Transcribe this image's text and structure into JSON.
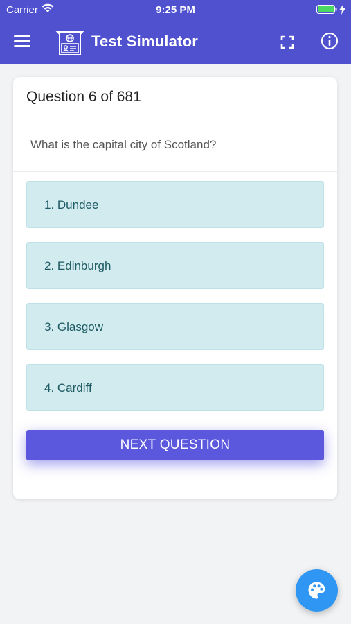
{
  "status_bar": {
    "carrier": "Carrier",
    "time": "9:25 PM"
  },
  "app_bar": {
    "title": "Test Simulator",
    "icons": [
      "menu-icon",
      "logo-icon",
      "fullscreen-icon",
      "info-icon"
    ]
  },
  "card": {
    "header": "Question 6 of 681",
    "question": "What is the capital city of Scotland?",
    "answers": [
      {
        "label": "1. Dundee"
      },
      {
        "label": "2. Edinburgh"
      },
      {
        "label": "3. Glasgow"
      },
      {
        "label": "4. Cardiff"
      }
    ],
    "next_label": "NEXT QUESTION"
  },
  "fab": {
    "icon": "palette-icon"
  },
  "colors": {
    "header": "#4f51cf",
    "answer_bg": "#d1ebef",
    "answer_text": "#1e5a63",
    "next_button": "#5b58de",
    "fab": "#2f97f3"
  }
}
